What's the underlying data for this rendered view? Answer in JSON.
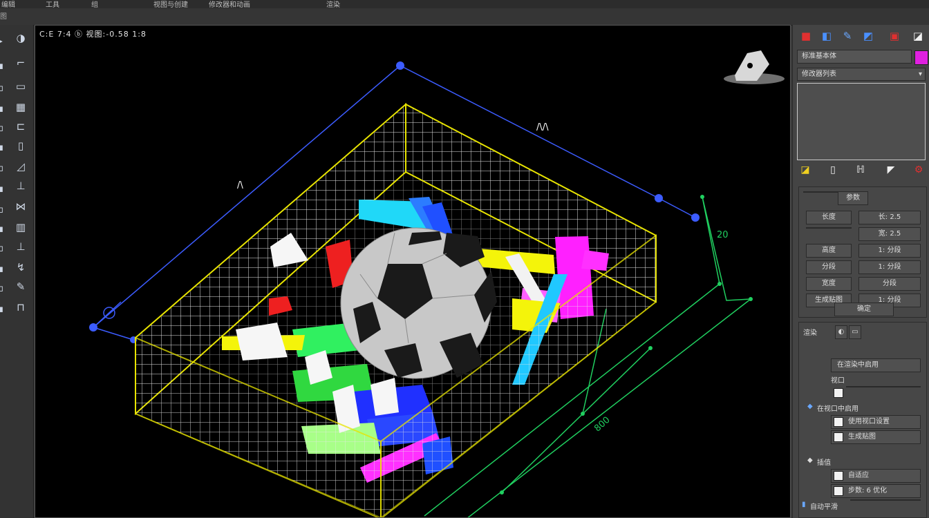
{
  "menubar": {
    "items": [
      "编辑",
      "工具",
      "组",
      "视图与创建",
      "修改器和动画",
      "渲染"
    ]
  },
  "subbar": {
    "label": "图"
  },
  "viewport": {
    "label": "C:E 7:4 ⓑ 视图:-0.58 1:8",
    "dimensions": {
      "top": "/\\/\\",
      "left": "/\\",
      "right": "20",
      "bottom": "800"
    }
  },
  "toolbar": {
    "left_icons": [
      "select-icon",
      "move-icon",
      "rotate-icon",
      "scale-icon",
      "link-icon",
      "unlink-icon",
      "bind-icon",
      "align-icon",
      "mirror-icon",
      "array-icon",
      "snap-icon",
      "curve-icon",
      "render-icon",
      "material-icon",
      "layer-icon"
    ],
    "right_icons": [
      "sphere-icon",
      "camera-icon",
      "monitor-icon",
      "grid-icon",
      "box-icon",
      "book-icon",
      "shape-icon",
      "light-icon",
      "helper-icon",
      "space-icon",
      "system-icon",
      "modifier-icon",
      "hierarchy-icon"
    ]
  },
  "command_panel": {
    "tab_icons": [
      "create-icon",
      "modify-icon",
      "hierarchy-icon",
      "motion-icon",
      "display-icon",
      "utilities-icon"
    ],
    "name_field": "标准基本体",
    "color": "#e020e0",
    "modifier_list": "修改器列表",
    "mini_tools": [
      "pin-icon",
      "show-result-icon",
      "unique-icon",
      "remove-icon",
      "configure-icon"
    ],
    "params": {
      "header": "参数",
      "rows": [
        {
          "label": "长度",
          "value": "长: 2.5"
        },
        {
          "label": "",
          "value": "宽: 2.5"
        },
        {
          "label": "高度",
          "value": "1: 分段"
        },
        {
          "label": "分段",
          "value": "1: 分段"
        },
        {
          "label": "宽度",
          "value": "分段"
        },
        {
          "label": "生成贴图",
          "value": "1: 分段"
        }
      ],
      "footer": "确定"
    },
    "render": {
      "header": "渲染",
      "items": [
        "在渲染中启用",
        "视口",
        "",
        "在视口中启用",
        "使用视口设置",
        "生成贴图"
      ],
      "section2": "插值",
      "items2": [
        "自适应",
        "步数: 6 优化"
      ],
      "section3": "自动平滑"
    }
  }
}
